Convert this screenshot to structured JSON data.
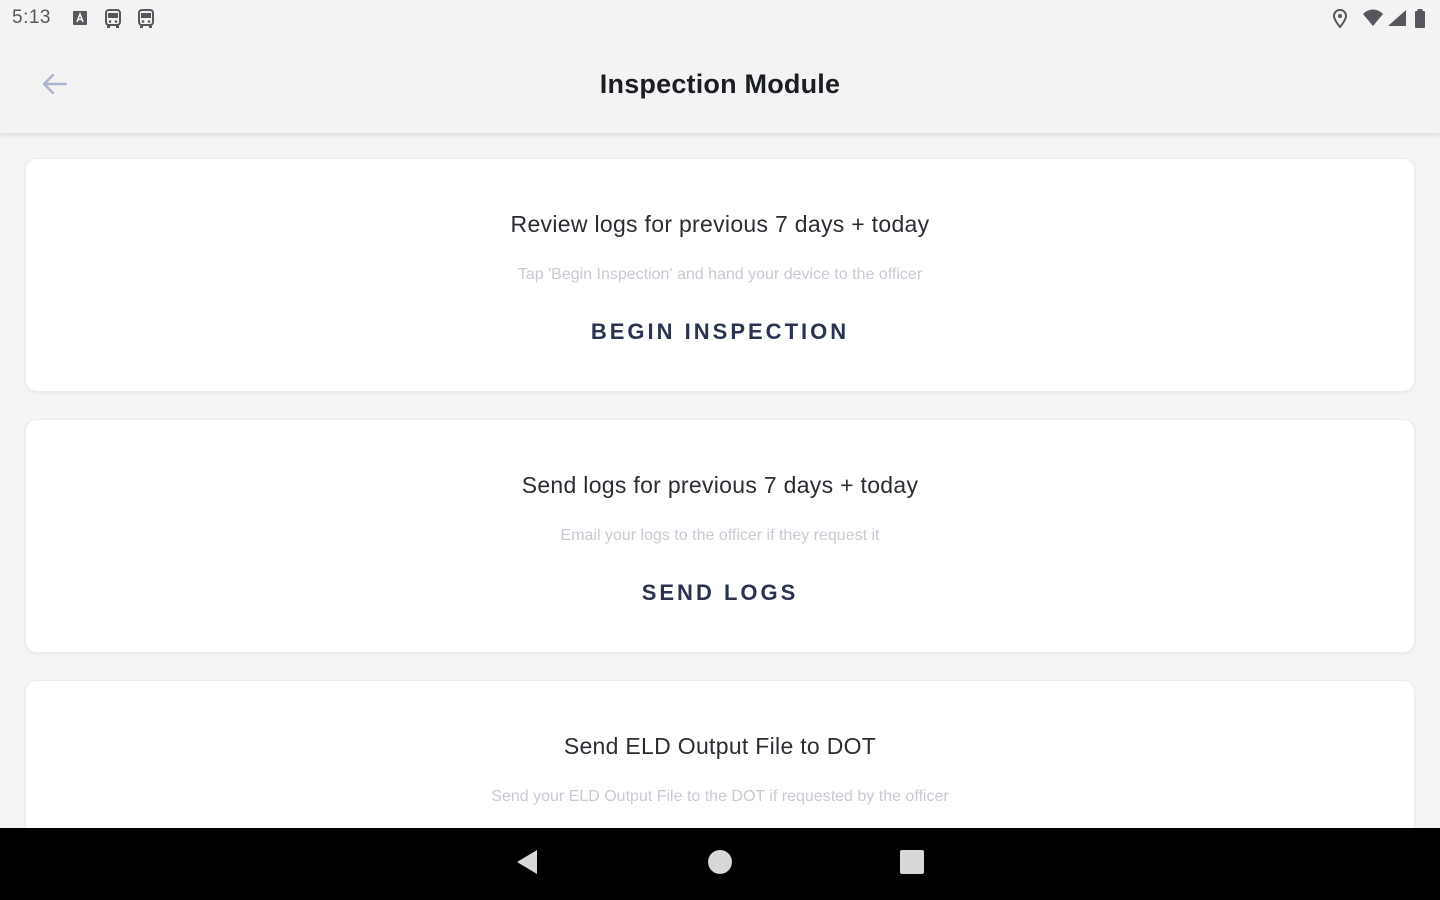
{
  "status_bar": {
    "time": "5:13"
  },
  "app_bar": {
    "title": "Inspection Module",
    "back_icon": "arrow-left-icon"
  },
  "cards": [
    {
      "title": "Review logs for previous 7 days + today",
      "subtitle": "Tap 'Begin Inspection' and hand your device to the officer",
      "action_label": "BEGIN INSPECTION"
    },
    {
      "title": "Send logs for previous 7 days + today",
      "subtitle": "Email your logs to the officer if they request it",
      "action_label": "SEND LOGS"
    },
    {
      "title": "Send ELD Output File to DOT",
      "subtitle": "Send your ELD Output File to the DOT if requested by the officer"
    }
  ],
  "nav_bar": {
    "back_icon": "triangle-back-icon",
    "home_icon": "circle-home-icon",
    "recents_icon": "square-recents-icon"
  },
  "colors": {
    "background": "#f5f5f6",
    "card": "#ffffff",
    "title": "#1b1d24",
    "action": "#2a3350",
    "subtitle": "#c9cad3",
    "nav_bar": "#000000"
  }
}
